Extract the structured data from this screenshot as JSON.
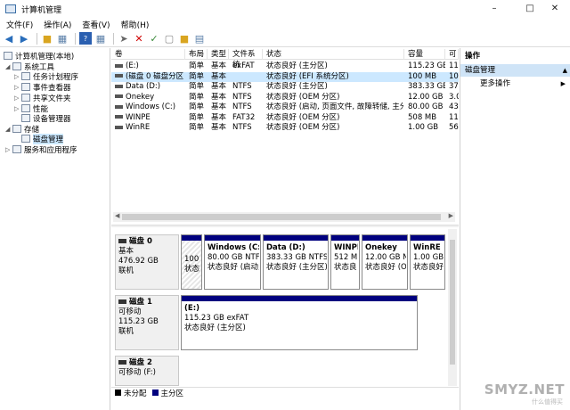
{
  "window": {
    "title": "计算机管理"
  },
  "menu": [
    {
      "label": "文件(F)"
    },
    {
      "label": "操作(A)"
    },
    {
      "label": "查看(V)"
    },
    {
      "label": "帮助(H)"
    }
  ],
  "tree": {
    "root": "计算机管理(本地)",
    "system_tools": "系统工具",
    "items": [
      "任务计划程序",
      "事件查看器",
      "共享文件夹",
      "性能",
      "设备管理器"
    ],
    "storage": "存储",
    "disk_mgmt": "磁盘管理",
    "services": "服务和应用程序"
  },
  "columns": [
    "卷",
    "布局",
    "类型",
    "文件系统",
    "状态",
    "容量",
    "可"
  ],
  "volumes": [
    {
      "name": "(E:)",
      "layout": "简单",
      "type": "基本",
      "fs": "exFAT",
      "status": "状态良好 (主分区)",
      "capacity": "115.23 GB",
      "free": "11"
    },
    {
      "name": "(磁盘 0 磁盘分区 1)",
      "layout": "简单",
      "type": "基本",
      "fs": "",
      "status": "状态良好 (EFI 系统分区)",
      "capacity": "100 MB",
      "free": "10"
    },
    {
      "name": "Data (D:)",
      "layout": "简单",
      "type": "基本",
      "fs": "NTFS",
      "status": "状态良好 (主分区)",
      "capacity": "383.33 GB",
      "free": "37"
    },
    {
      "name": "Onekey",
      "layout": "简单",
      "type": "基本",
      "fs": "NTFS",
      "status": "状态良好 (OEM 分区)",
      "capacity": "12.00 GB",
      "free": "3.0"
    },
    {
      "name": "Windows (C:)",
      "layout": "简单",
      "type": "基本",
      "fs": "NTFS",
      "status": "状态良好 (启动, 页面文件, 故障转储, 主分区)",
      "capacity": "80.00 GB",
      "free": "43"
    },
    {
      "name": "WINPE",
      "layout": "简单",
      "type": "基本",
      "fs": "FAT32",
      "status": "状态良好 (OEM 分区)",
      "capacity": "508 MB",
      "free": "11"
    },
    {
      "name": "WinRE",
      "layout": "简单",
      "type": "基本",
      "fs": "NTFS",
      "status": "状态良好 (OEM 分区)",
      "capacity": "1.00 GB",
      "free": "56"
    }
  ],
  "disks": [
    {
      "name": "磁盘 0",
      "line1": "基本",
      "line2": "476.92 GB",
      "line3": "联机",
      "parts": [
        {
          "title": "",
          "size": "100",
          "status": "状态"
        },
        {
          "title": "Windows  (C:)",
          "size": "80.00 GB NTFS",
          "status": "状态良好 (启动,"
        },
        {
          "title": "Data  (D:)",
          "size": "383.33 GB NTFS",
          "status": "状态良好 (主分区)"
        },
        {
          "title": "WINPE",
          "size": "512 MI",
          "status": "状态良"
        },
        {
          "title": "Onekey",
          "size": "12.00 GB N1",
          "status": "状态良好 (OI"
        },
        {
          "title": "WinRE",
          "size": "1.00 GB",
          "status": "状态良好"
        }
      ]
    },
    {
      "name": "磁盘 1",
      "line1": "可移动",
      "line2": "115.23 GB",
      "line3": "联机",
      "parts": [
        {
          "title": "(E:)",
          "size": "115.23 GB exFAT",
          "status": "状态良好 (主分区)"
        }
      ]
    },
    {
      "name": "磁盘 2",
      "line1": "可移动 (F:)",
      "line2": "",
      "line3": "",
      "parts": []
    }
  ],
  "legend": [
    {
      "label": "未分配",
      "color": "#000000"
    },
    {
      "label": "主分区",
      "color": "#00007f"
    }
  ],
  "actions": {
    "header": "操作",
    "section": "磁盘管理",
    "more": "更多操作"
  },
  "watermark": {
    "text": "SMYZ.NET",
    "sub": "什么值得买"
  }
}
